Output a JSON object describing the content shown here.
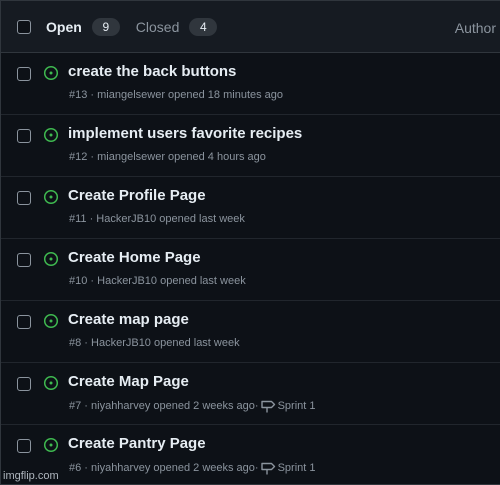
{
  "header": {
    "open_label": "Open",
    "open_count": "9",
    "closed_label": "Closed",
    "closed_count": "4",
    "author_label": "Author"
  },
  "colors": {
    "open_status": "#3fb950",
    "background": "#0d1117",
    "header_background": "#161b22"
  },
  "issues": [
    {
      "title": "create the back buttons",
      "meta": "#13 · miangelsewer opened 18 minutes ago",
      "milestone": ""
    },
    {
      "title": "implement users favorite recipes",
      "meta": "#12 · miangelsewer opened 4 hours ago",
      "milestone": ""
    },
    {
      "title": "Create Profile Page",
      "meta": "#11 · HackerJB10 opened last week",
      "milestone": ""
    },
    {
      "title": "Create Home Page",
      "meta": "#10 · HackerJB10 opened last week",
      "milestone": ""
    },
    {
      "title": "Create map page",
      "meta": "#8 · HackerJB10 opened last week",
      "milestone": ""
    },
    {
      "title": "Create Map Page",
      "meta": "#7 · niyahharvey opened 2 weeks ago·",
      "milestone": "Sprint 1"
    },
    {
      "title": "Create Pantry Page",
      "meta": "#6 · niyahharvey opened 2 weeks ago·",
      "milestone": "Sprint 1"
    }
  ],
  "watermark": "imgflip.com"
}
